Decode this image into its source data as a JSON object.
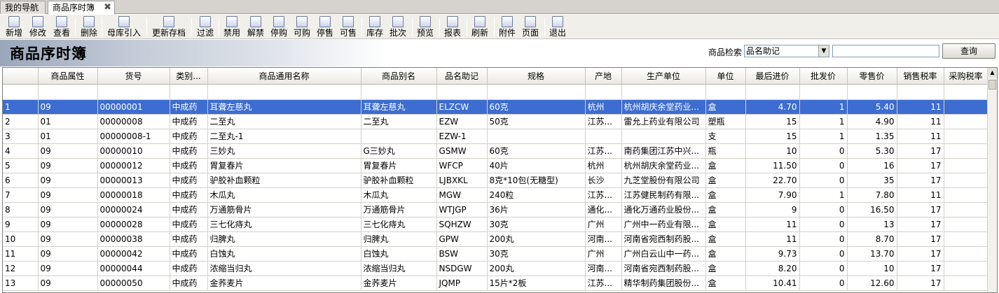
{
  "tabs": [
    {
      "label": "我的导航"
    },
    {
      "label": "商品序时簿"
    }
  ],
  "tab_close": "✖",
  "toolbar": [
    {
      "label": "新增",
      "icon": "new-doc-icon"
    },
    {
      "label": "修改",
      "icon": "edit-icon"
    },
    {
      "label": "查看",
      "icon": "view-icon"
    },
    {
      "label": "删除",
      "icon": "delete-icon"
    },
    {
      "label": "母库引入",
      "icon": "import-icon"
    },
    {
      "label": "更新存档",
      "icon": "update-icon"
    },
    {
      "label": "过滤",
      "icon": "filter-icon"
    },
    {
      "label": "禁用",
      "icon": "disable-icon"
    },
    {
      "label": "解禁",
      "icon": "enable-icon"
    },
    {
      "label": "停购",
      "icon": "stop-purchase-icon"
    },
    {
      "label": "可购",
      "icon": "allow-purchase-icon"
    },
    {
      "label": "停售",
      "icon": "stop-sale-icon"
    },
    {
      "label": "可售",
      "icon": "allow-sale-icon"
    },
    {
      "label": "库存",
      "icon": "stock-icon"
    },
    {
      "label": "批次",
      "icon": "batch-icon"
    },
    {
      "label": "预览",
      "icon": "preview-icon"
    },
    {
      "label": "报表",
      "icon": "report-icon"
    },
    {
      "label": "刷新",
      "icon": "refresh-icon"
    },
    {
      "label": "附件",
      "icon": "attachment-icon"
    },
    {
      "label": "页面",
      "icon": "page-icon"
    },
    {
      "label": "退出",
      "icon": "exit-icon"
    }
  ],
  "banner": {
    "title": "商品序时簿",
    "search_label": "商品检索",
    "search_field": "品名助记",
    "search_value": "",
    "search_button": "查询"
  },
  "grid": {
    "columns": [
      "商品属性",
      "货号",
      "类别...",
      "商品通用名称",
      "商品别名",
      "品名助记",
      "规格",
      "产地",
      "生产单位",
      "单位",
      "最后进价",
      "批发价",
      "零售价",
      "销售税率",
      "采购税率"
    ],
    "rows": [
      [
        "1",
        "09",
        "00000001",
        "中成药",
        "耳聋左慈丸",
        "耳聋左慈丸",
        "ELZCW",
        "60克",
        "杭州",
        "杭州胡庆余堂药业...",
        "盒",
        "4.70",
        "1",
        "5.40",
        "11",
        ""
      ],
      [
        "2",
        "01",
        "00000008",
        "中成药",
        "二至丸",
        "二至丸",
        "EZW",
        "50克",
        "江苏...",
        "雷允上药业有限公司",
        "塑瓶",
        "15",
        "1",
        "4.90",
        "11",
        ""
      ],
      [
        "3",
        "01",
        "00000008-1",
        "中成药",
        "二至丸-1",
        "",
        "EZW-1",
        "",
        "",
        "",
        "支",
        "15",
        "1",
        "1.35",
        "11",
        ""
      ],
      [
        "4",
        "09",
        "00000010",
        "中成药",
        "三妙丸",
        "G三妙丸",
        "GSMW",
        "60克",
        "江苏...",
        "南药集团江苏中兴...",
        "瓶",
        "10",
        "0",
        "5.30",
        "17",
        ""
      ],
      [
        "5",
        "09",
        "00000012",
        "中成药",
        "胃复春片",
        "胃复春片",
        "WFCP",
        "40片",
        "杭州",
        "杭州胡庆余堂药业...",
        "盒",
        "11.50",
        "0",
        "16",
        "17",
        ""
      ],
      [
        "6",
        "09",
        "00000013",
        "中成药",
        "驴胶补血颗粒",
        "驴胶补血颗粒",
        "LJBXKL",
        "8克*10包(无糖型)",
        "长沙",
        "九芝堂股份有限公司",
        "盒",
        "22.70",
        "0",
        "35",
        "17",
        ""
      ],
      [
        "7",
        "09",
        "00000018",
        "中成药",
        "木瓜丸",
        "木瓜丸",
        "MGW",
        "240粒",
        "江苏...",
        "江苏健民制药有限...",
        "盒",
        "7.90",
        "1",
        "7.80",
        "11",
        ""
      ],
      [
        "8",
        "09",
        "00000024",
        "中成药",
        "万通筋骨片",
        "万通筋骨片",
        "WTJGP",
        "36片",
        "通化...",
        "通化万通药业股份...",
        "盒",
        "9",
        "0",
        "16.50",
        "17",
        ""
      ],
      [
        "9",
        "09",
        "00000028",
        "中成药",
        "三七化痔丸",
        "三七化痔丸",
        "SQHZW",
        "30克",
        "广州",
        "广州中一药业有限...",
        "盒",
        "11",
        "0",
        "13",
        "17",
        ""
      ],
      [
        "10",
        "09",
        "00000038",
        "中成药",
        "归脾丸",
        "归脾丸",
        "GPW",
        "200丸",
        "河南...",
        "河南省宛西制药股...",
        "盒",
        "11",
        "0",
        "8.70",
        "17",
        ""
      ],
      [
        "11",
        "09",
        "00000042",
        "中成药",
        "白蚀丸",
        "白蚀丸",
        "BSW",
        "30克",
        "广州",
        "广州白云山中一药...",
        "盒",
        "9.73",
        "0",
        "13.70",
        "17",
        ""
      ],
      [
        "12",
        "09",
        "00000044",
        "中成药",
        "浓缩当归丸",
        "浓缩当归丸",
        "NSDGW",
        "200丸",
        "河南...",
        "河南省宛西制药股...",
        "盒",
        "8.20",
        "0",
        "10",
        "17",
        ""
      ],
      [
        "13",
        "09",
        "00000050",
        "中成药",
        "金荞麦片",
        "金荞麦片",
        "JQMP",
        "15片*2板",
        "江苏...",
        "精华制药集团股份...",
        "盒",
        "10.41",
        "0",
        "12.60",
        "17",
        ""
      ]
    ],
    "selected_row": 0
  },
  "colors": {
    "selection": "#3d6dd0",
    "toolbar_bg": "#f0efea",
    "tab_bg": "#d6d3ce"
  }
}
